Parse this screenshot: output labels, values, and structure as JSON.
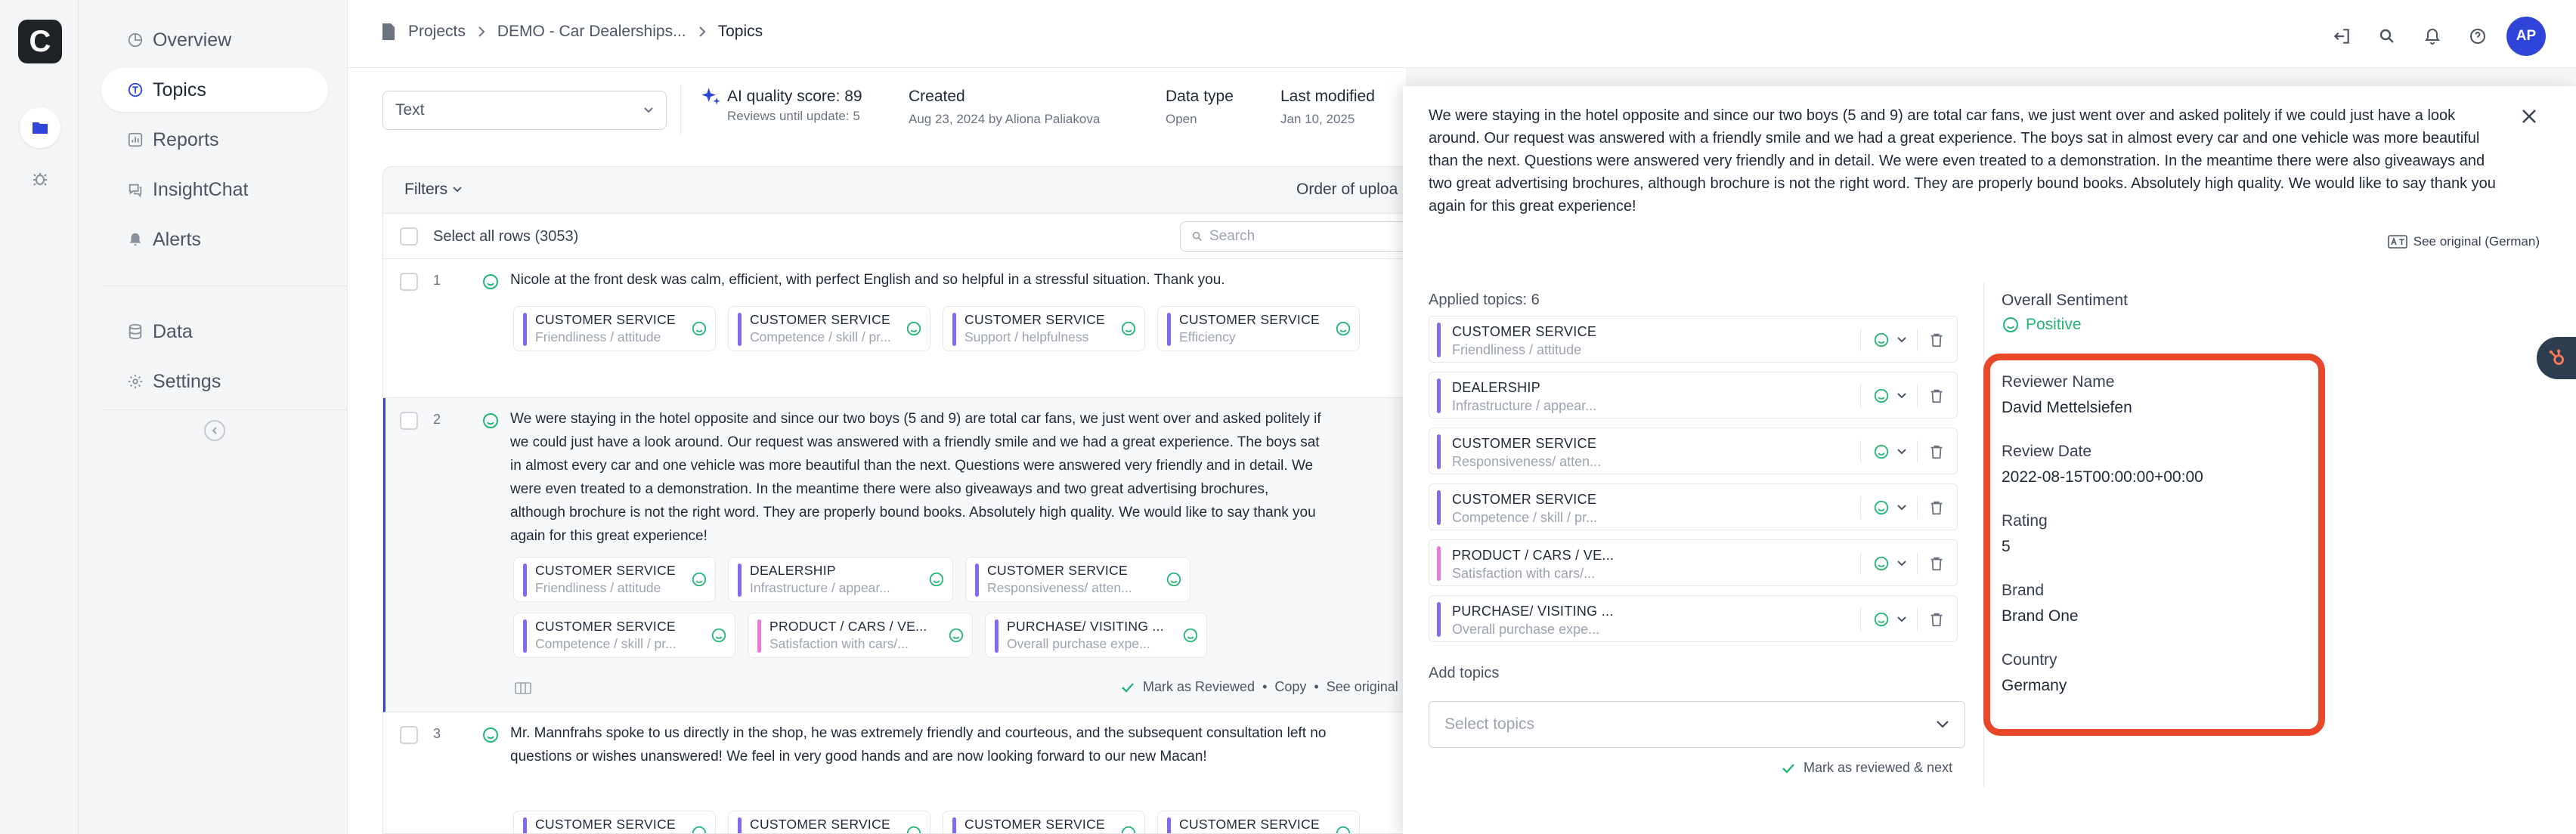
{
  "app": {
    "logo_letter": "C"
  },
  "sidebar": {
    "items": [
      {
        "label": "Overview",
        "icon": "chart-pie-icon"
      },
      {
        "label": "Topics",
        "icon": "topics-icon"
      },
      {
        "label": "Reports",
        "icon": "chart-bar-icon"
      },
      {
        "label": "InsightChat",
        "icon": "chat-icon"
      },
      {
        "label": "Alerts",
        "icon": "bell-icon"
      }
    ],
    "items2": [
      {
        "label": "Data",
        "icon": "database-icon"
      },
      {
        "label": "Settings",
        "icon": "gear-icon"
      }
    ]
  },
  "breadcrumb": {
    "projects": "Projects",
    "project": "DEMO - Car Dealerships...",
    "current": "Topics"
  },
  "user": {
    "initials": "AP"
  },
  "toolbar": {
    "text_select": "Text",
    "ai_quality": "AI quality score: 89",
    "reviews_until": "Reviews until update: 5",
    "created_label": "Created",
    "created_value": "Aug 23, 2024 by Aliona Paliakova",
    "datatype_label": "Data type",
    "datatype_value": "Open",
    "modified_label": "Last modified",
    "modified_value": "Jan 10, 2025"
  },
  "list": {
    "filters": "Filters",
    "order": "Order of uploa",
    "select_all": "Select all rows (3053)",
    "search_placeholder": "Search",
    "rows": [
      {
        "num": "1",
        "text": "Nicole at the front desk was calm, efficient, with perfect English and so helpful in a stressful situation. Thank you."
      },
      {
        "num": "2",
        "text": "We were staying in the hotel opposite and since our two boys (5 and 9) are total car fans, we just went over and asked politely if we could just have a look around. Our request was answered with a friendly smile and we had a great experience. The boys sat in almost every car and one vehicle was more beautiful than the next. Questions were answered very friendly and in detail. We were even treated to a demonstration. In the meantime there were also giveaways and two great advertising brochures, although brochure is not the right word. They are properly bound books. Absolutely high quality. We would like to say thank you again for this great experience!"
      },
      {
        "num": "3",
        "text": "Mr. Mannfrahs spoke to us directly in the shop, he was extremely friendly and courteous, and the subsequent consultation left no questions or wishes unanswered! We feel in very good hands and are now looking forward to our new Macan!"
      }
    ],
    "row1_chips": [
      {
        "t1": "CUSTOMER SERVICE",
        "t2": "Friendliness / attitude"
      },
      {
        "t1": "CUSTOMER SERVICE",
        "t2": "Competence / skill / pr..."
      },
      {
        "t1": "CUSTOMER SERVICE",
        "t2": "Support / helpfulness"
      },
      {
        "t1": "CUSTOMER SERVICE",
        "t2": "Efficiency"
      }
    ],
    "row2_chips": [
      {
        "t1": "CUSTOMER SERVICE",
        "t2": "Friendliness / attitude"
      },
      {
        "t1": "DEALERSHIP",
        "t2": "Infrastructure / appear..."
      },
      {
        "t1": "CUSTOMER SERVICE",
        "t2": "Responsiveness/ atten..."
      },
      {
        "t1": "CUSTOMER SERVICE",
        "t2": "Competence / skill / pr..."
      },
      {
        "t1": "PRODUCT / CARS / VE...",
        "t2": "Satisfaction with cars/..."
      },
      {
        "t1": "PURCHASE/ VISITING ...",
        "t2": "Overall purchase expe..."
      }
    ],
    "row3_chips": [
      {
        "t1": "CUSTOMER SERVICE"
      },
      {
        "t1": "CUSTOMER SERVICE"
      },
      {
        "t1": "CUSTOMER SERVICE"
      },
      {
        "t1": "CUSTOMER SERVICE"
      }
    ],
    "row2_actions": {
      "mark": "Mark as Reviewed",
      "copy": "Copy",
      "original": "See original (Germ"
    }
  },
  "panel": {
    "text": "We were staying in the hotel opposite and since our two boys (5 and 9) are total car fans, we just went over and asked politely if we could just have a look around. Our request was answered with a friendly smile and we had a great experience. The boys sat in almost every car and one vehicle was more beautiful than the next. Questions were answered very friendly and in detail. We were even treated to a demonstration. In the meantime there were also giveaways and two great advertising brochures, although brochure is not the right word. They are properly bound books. Absolutely high quality. We would like to say thank you again for this great experience!",
    "see_original": "See original (German)",
    "applied_topics": "Applied topics: 6",
    "topics": [
      {
        "t1": "CUSTOMER SERVICE",
        "t2": "Friendliness / attitude"
      },
      {
        "t1": "DEALERSHIP",
        "t2": "Infrastructure / appear..."
      },
      {
        "t1": "CUSTOMER SERVICE",
        "t2": "Responsiveness/ atten..."
      },
      {
        "t1": "CUSTOMER SERVICE",
        "t2": "Competence / skill / pr..."
      },
      {
        "t1": "PRODUCT / CARS / VE...",
        "t2": "Satisfaction with cars/..."
      },
      {
        "t1": "PURCHASE/ VISITING ...",
        "t2": "Overall purchase expe..."
      }
    ],
    "add_topics": "Add topics",
    "select_topics_placeholder": "Select topics",
    "mark_next": "Mark as reviewed & next",
    "sentiment_label": "Overall Sentiment",
    "sentiment_value": "Positive",
    "meta": [
      {
        "label": "Reviewer Name",
        "value": "David Mettelsiefen"
      },
      {
        "label": "Review Date",
        "value": "2022-08-15T00:00:00+00:00"
      },
      {
        "label": "Rating",
        "value": "5"
      },
      {
        "label": "Brand",
        "value": "Brand One"
      },
      {
        "label": "Country",
        "value": "Germany"
      }
    ]
  },
  "colors": {
    "accent": "#2f45d9",
    "positive": "#22b573",
    "highlight": "#e8472a",
    "bar_purple": "#7c6cf0",
    "bar_pink": "#e879d9",
    "bar_blue": "#6ea0f5",
    "hubspot": "#2d3e50"
  }
}
